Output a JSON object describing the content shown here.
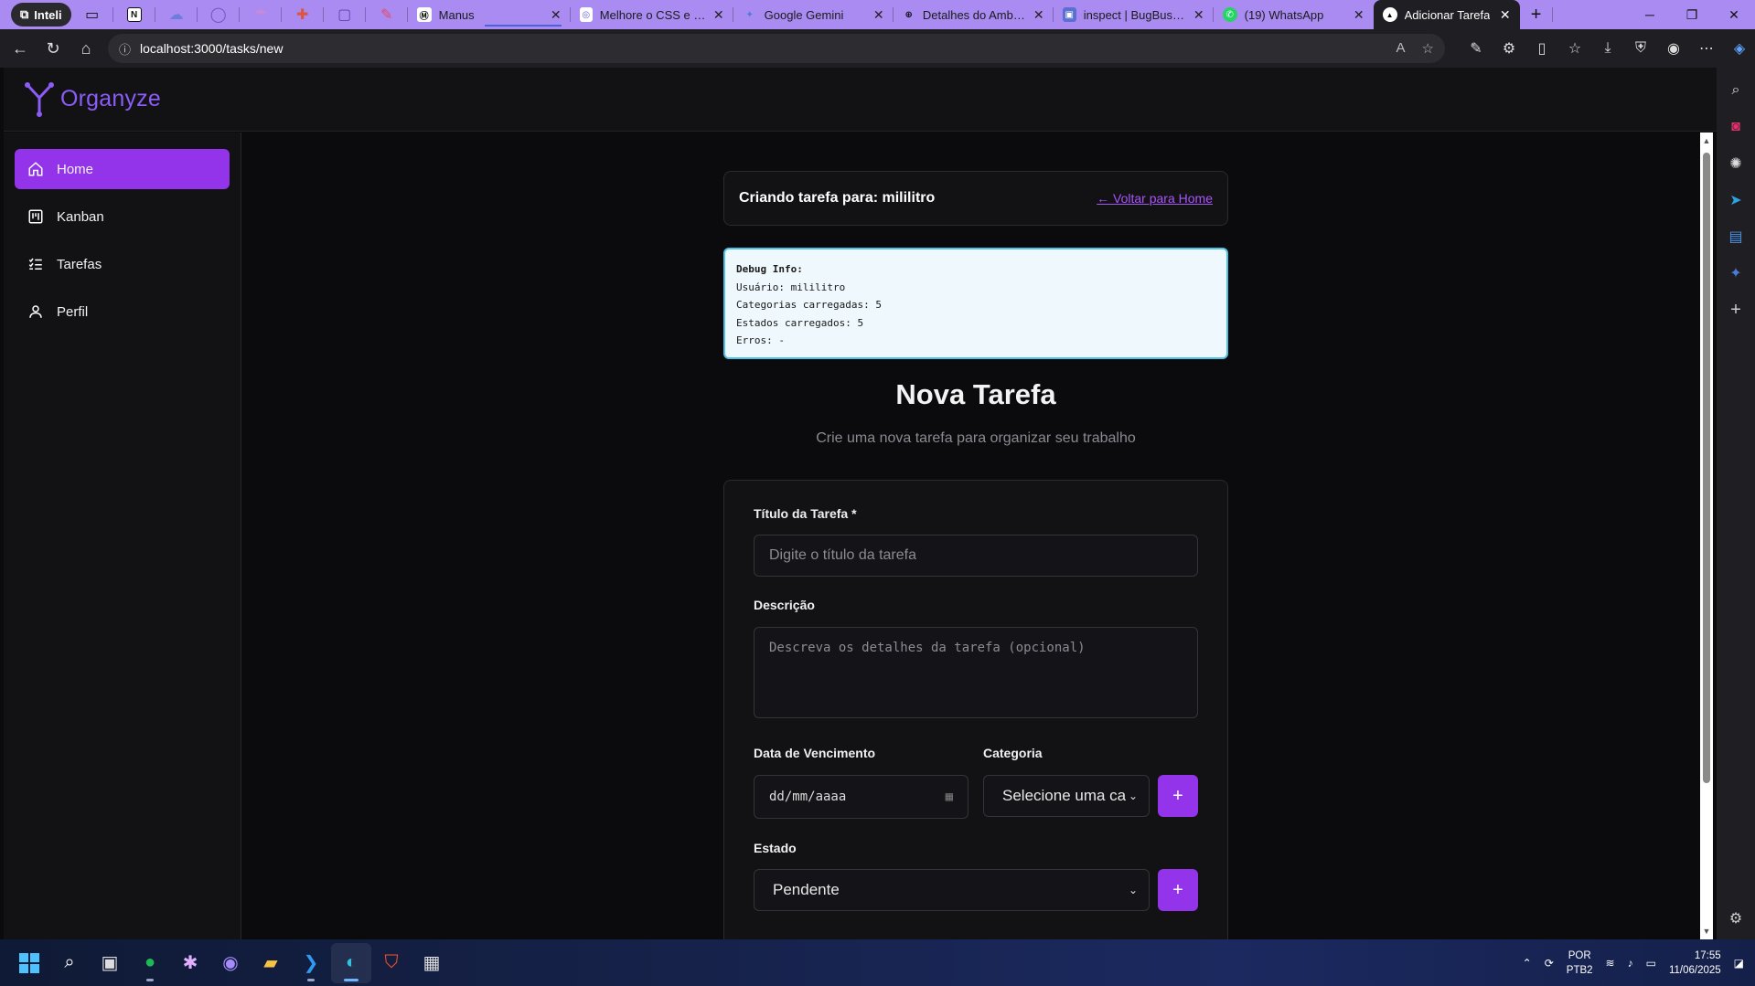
{
  "browser": {
    "profile_label": "Inteli",
    "tabs": [
      {
        "title": "Manus",
        "fav": "Ⓜ",
        "color": "#222"
      },
      {
        "title": "Melhore o CSS e a res",
        "fav": "◎",
        "color": "#6b5bd6"
      },
      {
        "title": "Google Gemini",
        "fav": "✦",
        "color": "#4b7bd8"
      },
      {
        "title": "Detalhes do Ambiente",
        "fav": "⊕",
        "color": "#222"
      },
      {
        "title": "inspect | BugBusters",
        "fav": "▣",
        "color": "#5a6fd0"
      },
      {
        "title": "(19) WhatsApp",
        "fav": "✆",
        "color": "#25d366"
      },
      {
        "title": "Adicionar Tarefa",
        "fav": "▲",
        "color": "#fff"
      }
    ],
    "url": "localhost:3000/tasks/new"
  },
  "app": {
    "logo": "Organyze",
    "nav": [
      {
        "label": "Home",
        "icon": "home-icon"
      },
      {
        "label": "Kanban",
        "icon": "kanban-icon"
      },
      {
        "label": "Tarefas",
        "icon": "tasks-list-icon"
      },
      {
        "label": "Perfil",
        "icon": "user-icon"
      }
    ],
    "header": {
      "creating_for": "Criando tarefa para: mililitro",
      "back_link": "← Voltar para Home"
    },
    "debug": {
      "title": "Debug Info:",
      "user": "Usuário: mililitro",
      "categories": "Categorias carregadas: 5",
      "states": "Estados carregados: 5",
      "errors": "Erros: -"
    },
    "page_title": "Nova Tarefa",
    "page_subtitle": "Crie uma nova tarefa para organizar seu trabalho",
    "form": {
      "title_label": "Título da Tarefa *",
      "title_placeholder": "Digite o título da tarefa",
      "desc_label": "Descrição",
      "desc_placeholder": "Descreva os detalhes da tarefa (opcional)",
      "due_label": "Data de Vencimento",
      "due_placeholder": "dd/mm/aaaa",
      "category_label": "Categoria",
      "category_value": "Selecione uma ca",
      "state_label": "Estado",
      "state_value": "Pendente",
      "add_symbol": "+"
    }
  },
  "taskbar": {
    "lang_top": "POR",
    "lang_bottom": "PTB2",
    "time": "17:55",
    "date": "11/06/2025"
  },
  "colors": {
    "accent": "#9333ea",
    "logo": "#8b5cf6",
    "tabbar": "#a98bf2"
  }
}
